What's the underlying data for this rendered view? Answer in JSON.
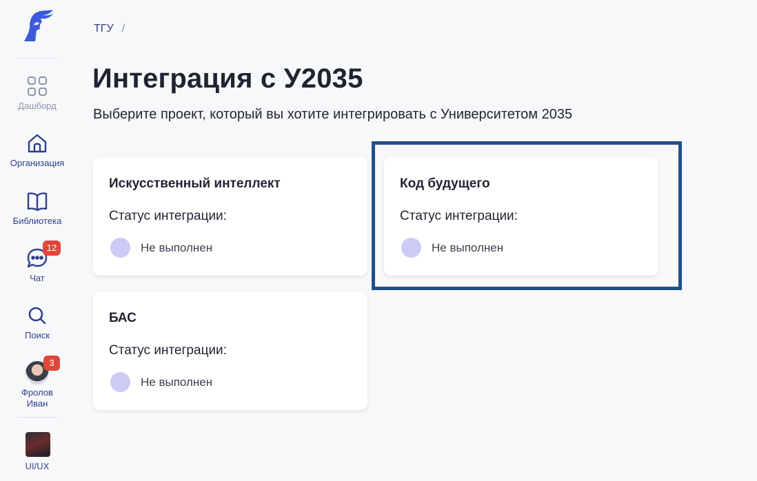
{
  "sidebar": {
    "items": [
      {
        "label": "Дашборд",
        "icon": "grid-icon"
      },
      {
        "label": "Организация",
        "icon": "home-icon"
      },
      {
        "label": "Библиотека",
        "icon": "book-icon"
      },
      {
        "label": "Чат",
        "icon": "chat-icon",
        "badge": "12"
      },
      {
        "label": "Поиск",
        "icon": "search-icon"
      },
      {
        "label": "Фролов Иван",
        "icon": "avatar",
        "badge": "3"
      },
      {
        "label": "UI/UX",
        "icon": "workspace-thumbnail"
      }
    ]
  },
  "breadcrumb": {
    "root": "ТГУ",
    "separator": "/"
  },
  "page": {
    "title": "Интеграция с У2035",
    "subtitle": "Выберите проект, который вы хотите интегрировать с Университетом 2035"
  },
  "projects": [
    {
      "title": "Искусственный интеллект",
      "status_label": "Статус интеграции:",
      "status": "Не выполнен"
    },
    {
      "title": "Код будущего",
      "status_label": "Статус интеграции:",
      "status": "Не выполнен"
    },
    {
      "title": "БАС",
      "status_label": "Статус интеграции:",
      "status": "Не выполнен"
    }
  ],
  "colors": {
    "accent": "#2f3e8a",
    "badge": "#e0473b",
    "status_pending": "#cbcbf6",
    "highlight": "#1f4f8a"
  }
}
